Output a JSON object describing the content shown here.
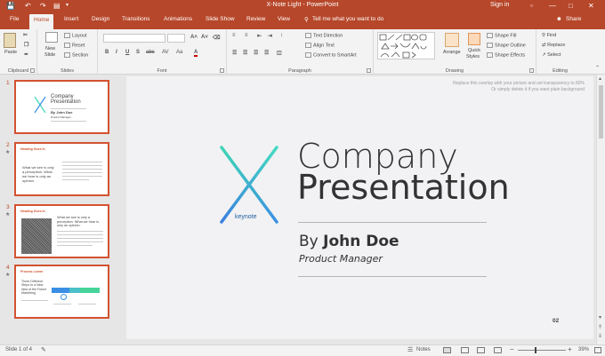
{
  "window": {
    "title": "X-Note Light  -  PowerPoint",
    "signin": "Sign in"
  },
  "tabs": [
    {
      "label": "File"
    },
    {
      "label": "Home"
    },
    {
      "label": "Insert"
    },
    {
      "label": "Design"
    },
    {
      "label": "Transitions"
    },
    {
      "label": "Animations"
    },
    {
      "label": "Slide Show"
    },
    {
      "label": "Review"
    },
    {
      "label": "View"
    },
    {
      "label": "Tell me what you want to do"
    }
  ],
  "share_label": "Share",
  "ribbon": {
    "clipboard": {
      "label": "Clipboard",
      "paste": "Paste"
    },
    "slides": {
      "label": "Slides",
      "new_slide": "New",
      "new_slide2": "Slide",
      "layout": "Layout",
      "reset": "Reset",
      "section": "Section"
    },
    "font": {
      "label": "Font",
      "bold": "B",
      "italic": "I",
      "underline": "U",
      "shadow": "S",
      "strike": "abc",
      "spacing": "AV",
      "case": "Aa",
      "color": "A"
    },
    "paragraph": {
      "label": "Paragraph",
      "text_direction": "Text Direction",
      "align_text": "Align Text",
      "smartart": "Convert to SmartArt"
    },
    "drawing": {
      "label": "Drawing",
      "arrange": "Arrange",
      "quick_styles": "Quick",
      "quick_styles2": "Styles",
      "shape_fill": "Shape Fill",
      "shape_outline": "Shape Outline",
      "shape_effects": "Shape Effects"
    },
    "editing": {
      "label": "Editing",
      "find": "Find",
      "replace": "Replace",
      "select": "Select"
    }
  },
  "thumbnails": [
    {
      "num": "1",
      "title": "Company",
      "title2": "Presentation",
      "by": "By John Doe",
      "role": "Product Manager"
    },
    {
      "num": "2",
      "heading": "Heading Goes In",
      "body": "What we see is only a perception. What we hear is only an opinion."
    },
    {
      "num": "3",
      "heading": "Heading Goes In",
      "body": "What we see is only a perception. What we hear is only an opinion."
    },
    {
      "num": "4",
      "heading": "Process Lorem",
      "body": "Three Different Steps to a New Idea of the Future Marketing"
    }
  ],
  "slide": {
    "overlay_note_1": "Replace this overlay with your picture and set transparency to 80%",
    "overlay_note_2": "Or simply delete it if you want plain background",
    "logo_letter": "X",
    "logo_caption": "keynote",
    "title_line1": "Company",
    "title_line2": "Presentation",
    "by_prefix": "By",
    "by_name": "John Doe",
    "role": "Product Manager",
    "page_number": "02"
  },
  "status": {
    "slide_info": "Slide 1 of 4",
    "notes": "Notes",
    "zoom": "39%"
  },
  "colors": {
    "accent": "#b7472a",
    "thumb_border": "#d35230",
    "logo_teal": "#3ed6b4",
    "logo_blue": "#3a8fe4"
  }
}
